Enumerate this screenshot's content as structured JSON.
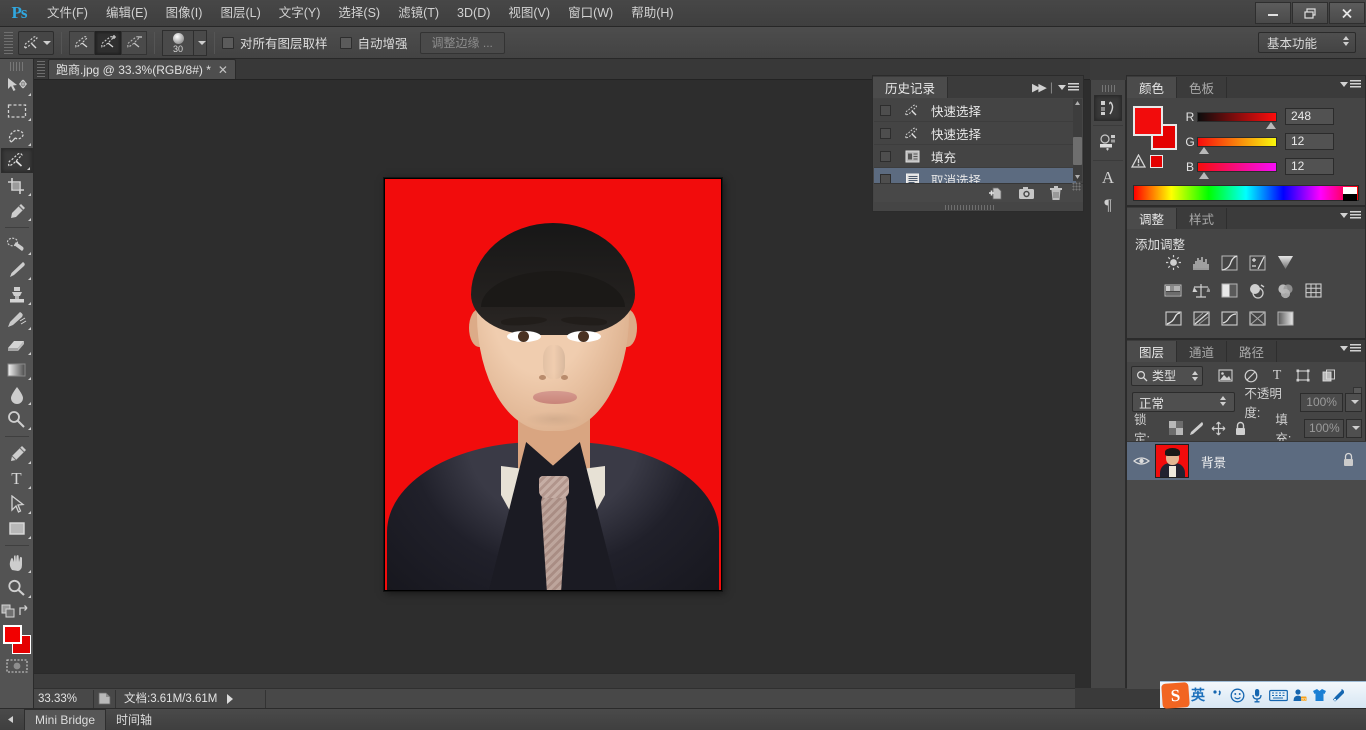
{
  "app": {
    "name": "Ps",
    "logo_color": "#31a8e0"
  },
  "menubar": {
    "items": [
      {
        "label": "文件(F)"
      },
      {
        "label": "编辑(E)"
      },
      {
        "label": "图像(I)"
      },
      {
        "label": "图层(L)"
      },
      {
        "label": "文字(Y)"
      },
      {
        "label": "选择(S)"
      },
      {
        "label": "滤镜(T)"
      },
      {
        "label": "3D(D)"
      },
      {
        "label": "视图(V)"
      },
      {
        "label": "窗口(W)"
      },
      {
        "label": "帮助(H)"
      }
    ],
    "window_controls": {
      "minimize": "—",
      "restore": "❐",
      "close": "✕"
    }
  },
  "options_bar": {
    "brush_size": "30",
    "sample_all_layers_label": "对所有图层取样",
    "auto_enhance_label": "自动增强",
    "refine_edge_label": "调整边缘 ...",
    "workspace": "基本功能",
    "modes": [
      "new-selection",
      "add-to-selection",
      "subtract-from-selection"
    ],
    "active_mode_index": 1
  },
  "toolbar": {
    "tools": [
      {
        "name": "move-tool"
      },
      {
        "name": "rectangular-marquee-tool"
      },
      {
        "name": "lasso-tool"
      },
      {
        "name": "quick-selection-tool",
        "active": true
      },
      {
        "name": "crop-tool"
      },
      {
        "name": "eyedropper-tool"
      },
      {
        "name": "spot-healing-brush-tool"
      },
      {
        "name": "brush-tool"
      },
      {
        "name": "clone-stamp-tool"
      },
      {
        "name": "history-brush-tool"
      },
      {
        "name": "eraser-tool"
      },
      {
        "name": "gradient-tool"
      },
      {
        "name": "blur-tool"
      },
      {
        "name": "dodge-tool"
      },
      {
        "name": "pen-tool"
      },
      {
        "name": "horizontal-type-tool"
      },
      {
        "name": "path-selection-tool"
      },
      {
        "name": "rectangle-tool"
      },
      {
        "name": "hand-tool"
      },
      {
        "name": "zoom-tool"
      }
    ],
    "type_tool_glyph": "T",
    "foreground_color": "#f20c0c",
    "background_color": "#e40000"
  },
  "document": {
    "tab_title": "跑商.jpg @ 33.3%(RGB/8#) *",
    "close_glyph": "✕"
  },
  "status_bar": {
    "zoom": "33.33%",
    "doc_info": "文档:3.61M/3.61M"
  },
  "bottom_tabs": {
    "items": [
      {
        "label": "Mini Bridge",
        "active": true
      },
      {
        "label": "时间轴",
        "active": false
      }
    ]
  },
  "icon_strip": {
    "buttons": [
      {
        "name": "history-panel-icon",
        "active": true
      },
      {
        "name": "actions-panel-icon",
        "active": false
      },
      {
        "name": "character-panel-icon",
        "glyph": "A",
        "active": false
      },
      {
        "name": "paragraph-panel-icon",
        "glyph": "¶",
        "active": false
      }
    ]
  },
  "history_panel": {
    "tab_label": "历史记录",
    "collapse_glyph": "▶▶",
    "items": [
      {
        "label": "快速选择",
        "icon": "quick-selection-icon",
        "selected": false
      },
      {
        "label": "快速选择",
        "icon": "quick-selection-icon",
        "selected": false
      },
      {
        "label": "填充",
        "icon": "fill-icon",
        "selected": false
      },
      {
        "label": "取消选择",
        "icon": "deselect-icon",
        "selected": true
      }
    ],
    "footer_buttons": [
      {
        "name": "new-document-from-state-button"
      },
      {
        "name": "new-snapshot-button"
      },
      {
        "name": "delete-state-button"
      }
    ]
  },
  "color_panel": {
    "tabs": [
      {
        "label": "颜色",
        "active": true
      },
      {
        "label": "色板",
        "active": false
      }
    ],
    "channels": [
      {
        "label": "R",
        "value": "248"
      },
      {
        "label": "G",
        "value": "12"
      },
      {
        "label": "B",
        "value": "12"
      }
    ],
    "foreground_color": "#f80c0c",
    "background_color": "#e40000",
    "out_of_gamut_warning": true
  },
  "adjustments_panel": {
    "tabs": [
      {
        "label": "调整",
        "active": true
      },
      {
        "label": "样式",
        "active": false
      }
    ],
    "title": "添加调整",
    "rows": [
      [
        "brightness-contrast-icon",
        "levels-icon",
        "curves-icon",
        "exposure-icon",
        "vibrance-icon"
      ],
      [
        "hue-saturation-icon",
        "color-balance-icon",
        "black-white-icon",
        "photo-filter-icon",
        "channel-mixer-icon",
        "color-lookup-icon"
      ],
      [
        "invert-icon",
        "posterize-icon",
        "threshold-icon",
        "selective-color-icon",
        "gradient-map-icon"
      ]
    ]
  },
  "layers_panel": {
    "tabs": [
      {
        "label": "图层",
        "active": true
      },
      {
        "label": "通道",
        "active": false
      },
      {
        "label": "路径",
        "active": false
      }
    ],
    "filter": {
      "type_label": "类型",
      "icons": [
        "filter-image-icon",
        "filter-adjustment-icon",
        "filter-type-icon",
        "filter-shape-icon",
        "filter-smart-object-icon"
      ]
    },
    "blend_mode": "正常",
    "opacity_label": "不透明度:",
    "opacity_value": "100%",
    "lock_label": "锁定:",
    "lock_icons": [
      "lock-transparent-pixels-icon",
      "lock-image-pixels-icon",
      "lock-position-icon",
      "lock-all-icon"
    ],
    "fill_label": "填充:",
    "fill_value": "100%",
    "layers": [
      {
        "name": "背景",
        "visible": true,
        "locked": true,
        "selected": true
      }
    ]
  },
  "ime": {
    "logo": "S",
    "mode": "英",
    "buttons": [
      {
        "name": "punctuation-toggle-icon",
        "glyph": "，"
      },
      {
        "name": "emoji-icon",
        "glyph": "☺"
      },
      {
        "name": "voice-input-icon",
        "glyph": "🎤"
      },
      {
        "name": "soft-keyboard-icon",
        "glyph": "⌨"
      },
      {
        "name": "avatar-2d-icon",
        "glyph": "☻"
      },
      {
        "name": "skin-icon",
        "glyph": "👕"
      },
      {
        "name": "settings-icon",
        "glyph": "🔧"
      }
    ]
  },
  "canvas": {
    "background_color": "#2d2d2d",
    "photo_background_color": "#f20c0c",
    "photo_border_color": "#000000",
    "subject_description": "证件照"
  }
}
